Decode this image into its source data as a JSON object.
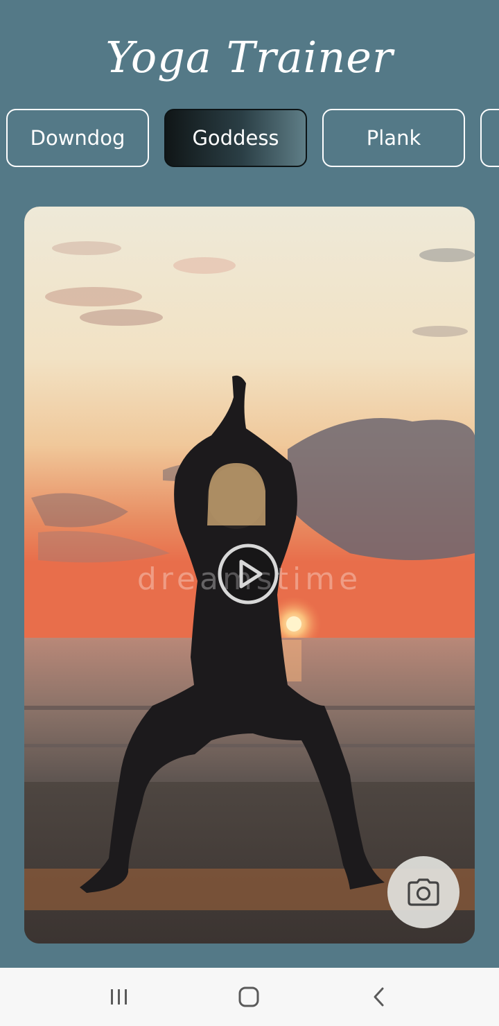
{
  "app": {
    "title": "Yoga Trainer"
  },
  "pose_tabs": [
    {
      "label": "Downdog",
      "active": false
    },
    {
      "label": "Goddess",
      "active": true
    },
    {
      "label": "Plank",
      "active": false
    }
  ],
  "video": {
    "watermark": "dreamstime",
    "play_icon": "play-circle-icon",
    "camera_icon": "camera-icon"
  },
  "nav_bar": {
    "icons": [
      "recent-apps-icon",
      "home-icon",
      "back-icon"
    ]
  },
  "colors": {
    "background": "#547987",
    "active_tab_dark": "#101617",
    "tab_border": "#ffffff",
    "nav_bar": "#f7f7f7"
  }
}
